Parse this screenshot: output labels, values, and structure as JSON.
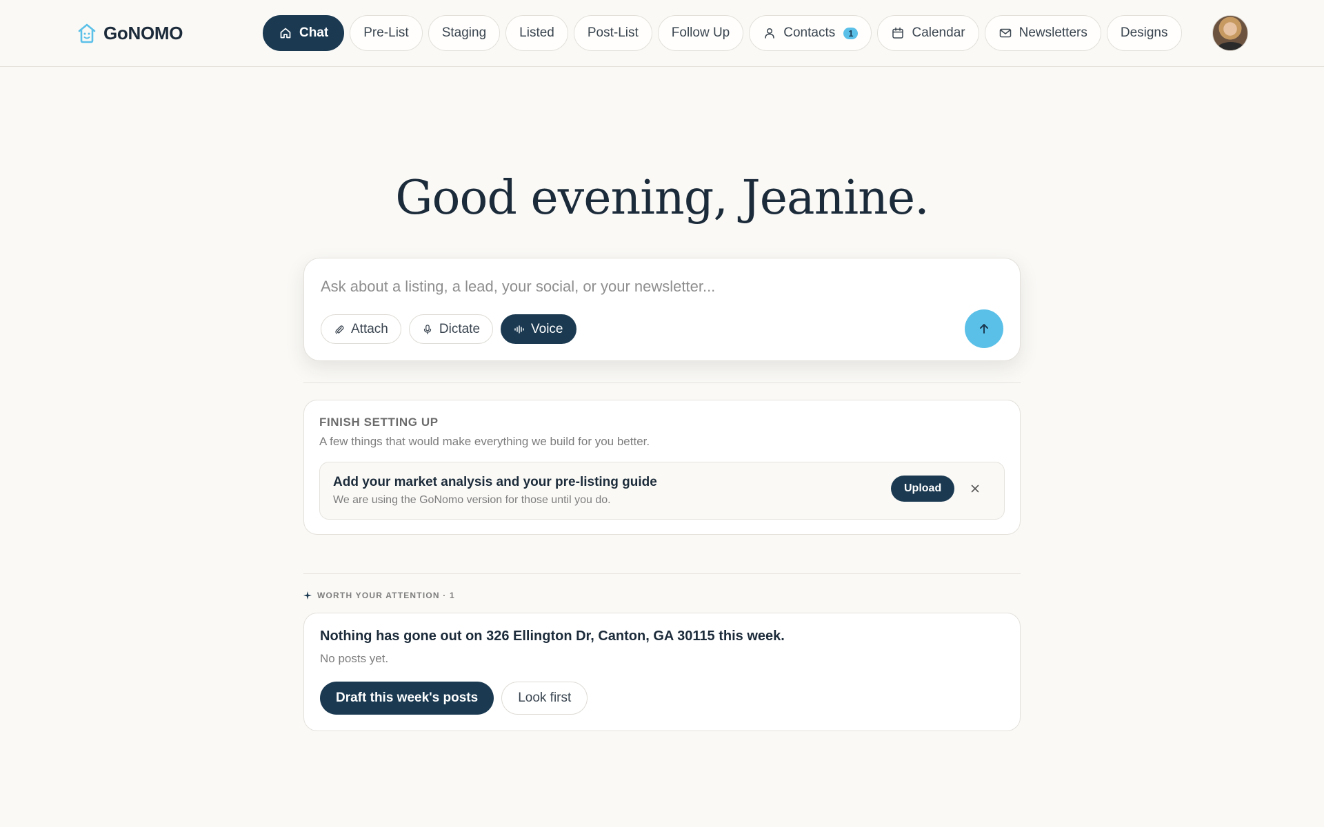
{
  "brand": {
    "name": "GoNOMO",
    "icon": "house-face-icon",
    "color": "#5bc0e8"
  },
  "nav": {
    "items": [
      {
        "label": "Chat",
        "icon": "home-icon",
        "active": true
      },
      {
        "label": "Pre-List"
      },
      {
        "label": "Staging"
      },
      {
        "label": "Listed"
      },
      {
        "label": "Post-List"
      },
      {
        "label": "Follow Up"
      },
      {
        "label": "Contacts",
        "icon": "person-icon",
        "badge": "1"
      },
      {
        "label": "Calendar",
        "icon": "calendar-icon"
      },
      {
        "label": "Newsletters",
        "icon": "mail-icon"
      },
      {
        "label": "Designs"
      }
    ],
    "avatar": "user-avatar"
  },
  "greeting": "Good evening, Jeanine.",
  "composer": {
    "placeholder": "Ask about a listing, a lead, your social, or your newsletter...",
    "attach_label": "Attach",
    "dictate_label": "Dictate",
    "voice_label": "Voice",
    "send_icon": "arrow-up-icon"
  },
  "setup": {
    "title": "FINISH SETTING UP",
    "subtitle": "A few things that would make everything we build for you better.",
    "task": {
      "title": "Add your market analysis and your pre-listing guide",
      "subtitle": "We are using the GoNomo version for those until you do.",
      "action_label": "Upload"
    }
  },
  "attention": {
    "label": "WORTH YOUR ATTENTION · 1",
    "card": {
      "title": "Nothing has gone out on 326 Ellington Dr, Canton, GA 30115 this week.",
      "subtitle": "No posts yet.",
      "primary_label": "Draft this week's posts",
      "secondary_label": "Look first"
    }
  },
  "colors": {
    "navy": "#1b3a52",
    "accent": "#5bc0e8",
    "background": "#faf9f6"
  }
}
